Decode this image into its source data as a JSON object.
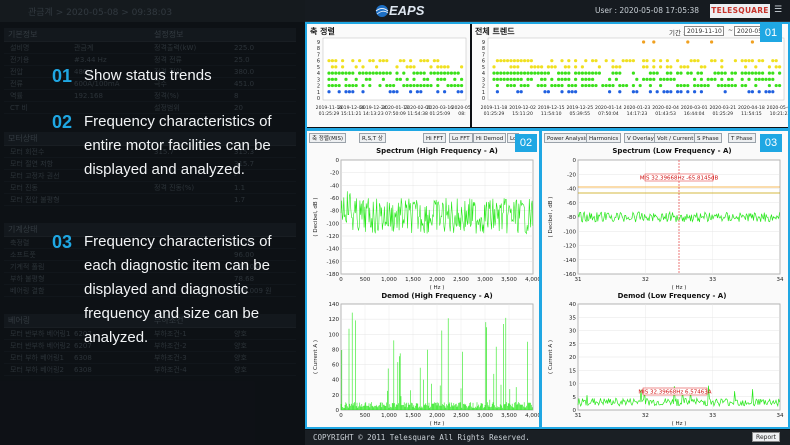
{
  "left_panel": {
    "breadcrumb": "관금계 > 2020-05-08 > 09:38:03",
    "sections": [
      {
        "title": "기본정보",
        "title2": "설정정보",
        "rows": [
          [
            "설비명",
            "관금계",
            "정격출력(kW)",
            "225.0"
          ],
          [
            "전기용",
            "#3.44 Hz",
            "정격 전류",
            "25.0"
          ],
          [
            "전압",
            "480V",
            "정격 전압",
            "380.0"
          ],
          [
            "전류",
            "600A/100mA",
            "극수",
            "451.0"
          ],
          [
            "역률",
            "192.168",
            "정격(%)",
            "8"
          ],
          [
            "CT 비",
            "",
            "설정범위",
            "20"
          ]
        ]
      },
      {
        "title": "모터상태",
        "title2": "",
        "rows": [
          [
            "모터 회전수",
            "",
            "315.7",
            "315.3"
          ],
          [
            "모터 절연 저항",
            "",
            "",
            "315.7"
          ],
          [
            "모터 고정자 권선",
            "",
            "",
            "-"
          ],
          [
            "모터 진동",
            "",
            "정격 진동(%)",
            "1.1"
          ],
          [
            "모터 전압 불평형",
            "",
            "",
            "1.7"
          ]
        ]
      },
      {
        "title": "기계상태",
        "title2": "",
        "rows": [
          [
            "축정렬",
            "",
            "",
            "99.36"
          ],
          [
            "소프트풋",
            "",
            "",
            "96.00"
          ],
          [
            "기계적 풀림",
            "",
            "",
            "141.04"
          ],
          [
            "부하 불평형",
            "",
            "",
            "78.68"
          ],
          [
            "베어링 결함",
            "",
            "",
            "629.009 원"
          ]
        ]
      },
      {
        "title": "베어링",
        "title2": "부하조건",
        "rows": [
          [
            "모터 반부하 베어링1",
            "6207",
            "부하조건-1",
            "양호"
          ],
          [
            "모터 반부하 베어링2",
            "6207",
            "부하조건-2",
            "양호"
          ],
          [
            "모터 부하 베어링1",
            "6308",
            "부하조건-3",
            "양호"
          ],
          [
            "모터 부하 베어링2",
            "6308",
            "부하조건-4",
            "양호"
          ]
        ]
      }
    ],
    "features": [
      {
        "num": "01",
        "text": "Show status trends"
      },
      {
        "num": "02",
        "text": "Frequency characteristics of entire motor facilities can be displayed and analyzed."
      },
      {
        "num": "03",
        "text": "Frequency characteristics of each diagnostic item can be displayed and diagnostic frequency and size can be analyzed."
      }
    ]
  },
  "header": {
    "logo_text": "EAPS",
    "user_info": "User : 2020-05-08 17:05:38",
    "brand": "TELESQUARE"
  },
  "trend_left": {
    "title": "축 정렬",
    "y_ticks": [
      "9",
      "8",
      "7",
      "6",
      "5",
      "4",
      "3",
      "2",
      "1",
      "0"
    ],
    "x_labels": [
      [
        "2019-11-16",
        "01:25:29"
      ],
      [
        "2019-12-06",
        "15:11:21"
      ],
      [
        "2019-12-24",
        "14:13:23"
      ],
      [
        "2020-01-13",
        "07:50:09"
      ],
      [
        "2020-02-01",
        "11:54:38"
      ],
      [
        "2020-03-16",
        "01:25:09"
      ],
      [
        "2020-05-",
        "08:"
      ]
    ]
  },
  "trend_right": {
    "title": "전체 트렌드",
    "period_label": "기간 :",
    "date_from": "2019-11-10",
    "date_to": "2020-05",
    "y_ticks": [
      "9",
      "8",
      "7",
      "6",
      "5",
      "4",
      "3",
      "2",
      "1",
      "0"
    ],
    "x_labels": [
      [
        "2019-11-18",
        "01:25:29"
      ],
      [
        "2019-12-02",
        "15:11:20"
      ],
      [
        "2019-12-15",
        "11:54:10"
      ],
      [
        "2019-12-25",
        "05:39:55"
      ],
      [
        "2020-01-14",
        "07:50:04"
      ],
      [
        "2020-01-23",
        "14:17:23"
      ],
      [
        "2020-02-04",
        "01:43:53"
      ],
      [
        "2020-03-01",
        "16:44:04"
      ],
      [
        "2020-03-21",
        "01:25:29"
      ],
      [
        "2020-04-18",
        "11:54:15"
      ],
      [
        "2020-05-01",
        "10:21:23"
      ]
    ]
  },
  "spectrum_panel": {
    "toolbar": [
      "축 정렬(MIS)",
      "R,S,T 상",
      "Hi FFT",
      "Lo FFT",
      "Hi Demod",
      "Lo"
    ],
    "spectrum_title": "Spectrum (High Frequency - A)",
    "spectrum_ylabel": "( Decibel, dB )",
    "spectrum_xlabel": "( Hz )",
    "spectrum_yticks": [
      "0",
      "-20",
      "-40",
      "-60",
      "-80",
      "-100",
      "-120",
      "-140",
      "-160",
      "-180"
    ],
    "spectrum_xticks": [
      "0",
      "500",
      "1,000",
      "1,500",
      "2,000",
      "2,500",
      "3,000",
      "3,500",
      "4,000"
    ],
    "demod_title": "Demod (High Frequency - A)",
    "demod_ylabel": "( Current A )",
    "demod_xlabel": "( Hz )",
    "demod_yticks": [
      "140",
      "120",
      "100",
      "80",
      "60",
      "40",
      "20",
      "0"
    ],
    "demod_xticks": [
      "0",
      "500",
      "1,000",
      "1,500",
      "2,000",
      "2,500",
      "3,000",
      "3,500",
      "4,000"
    ]
  },
  "detail_panel": {
    "toolbar": [
      "Power Analysis",
      "Harmonics",
      "V Overlay",
      "Volt / Current",
      "S Phase",
      "T Phase"
    ],
    "spectrum_title": "Spectrum (Low  Frequency - A)",
    "spectrum_ylabel": "( Decibel , dB )",
    "spectrum_xlabel": "( Hz )",
    "spectrum_marker": "MIS 32.39668Hz -65.8145dB",
    "spectrum_yticks": [
      "0",
      "-20",
      "-40",
      "-60",
      "-80",
      "-100",
      "-120",
      "-140",
      "-160"
    ],
    "spectrum_xticks": [
      "31",
      "32",
      "33",
      "34"
    ],
    "demod_title": "Demod (Low Frequency - A)",
    "demod_ylabel": "( Current A )",
    "demod_xlabel": "( Hz )",
    "demod_marker": "MIS 32.39668Hz 6.57463A",
    "demod_yticks": [
      "40",
      "35",
      "30",
      "25",
      "20",
      "15",
      "10",
      "5",
      "0"
    ],
    "demod_xticks": [
      "31",
      "32",
      "33",
      "34"
    ]
  },
  "badges": [
    "01",
    "02",
    "03"
  ],
  "footer": {
    "copyright": "COPYRIGHT © 2011 Telesquare All Rights Reserved.",
    "report_label": "Report"
  },
  "colors": {
    "accent": "#1fa7e3",
    "trace": "#27e81a",
    "orange": "#f0a020",
    "blue": "#2060e0",
    "yellow": "#f0e020",
    "green": "#3be01a"
  }
}
